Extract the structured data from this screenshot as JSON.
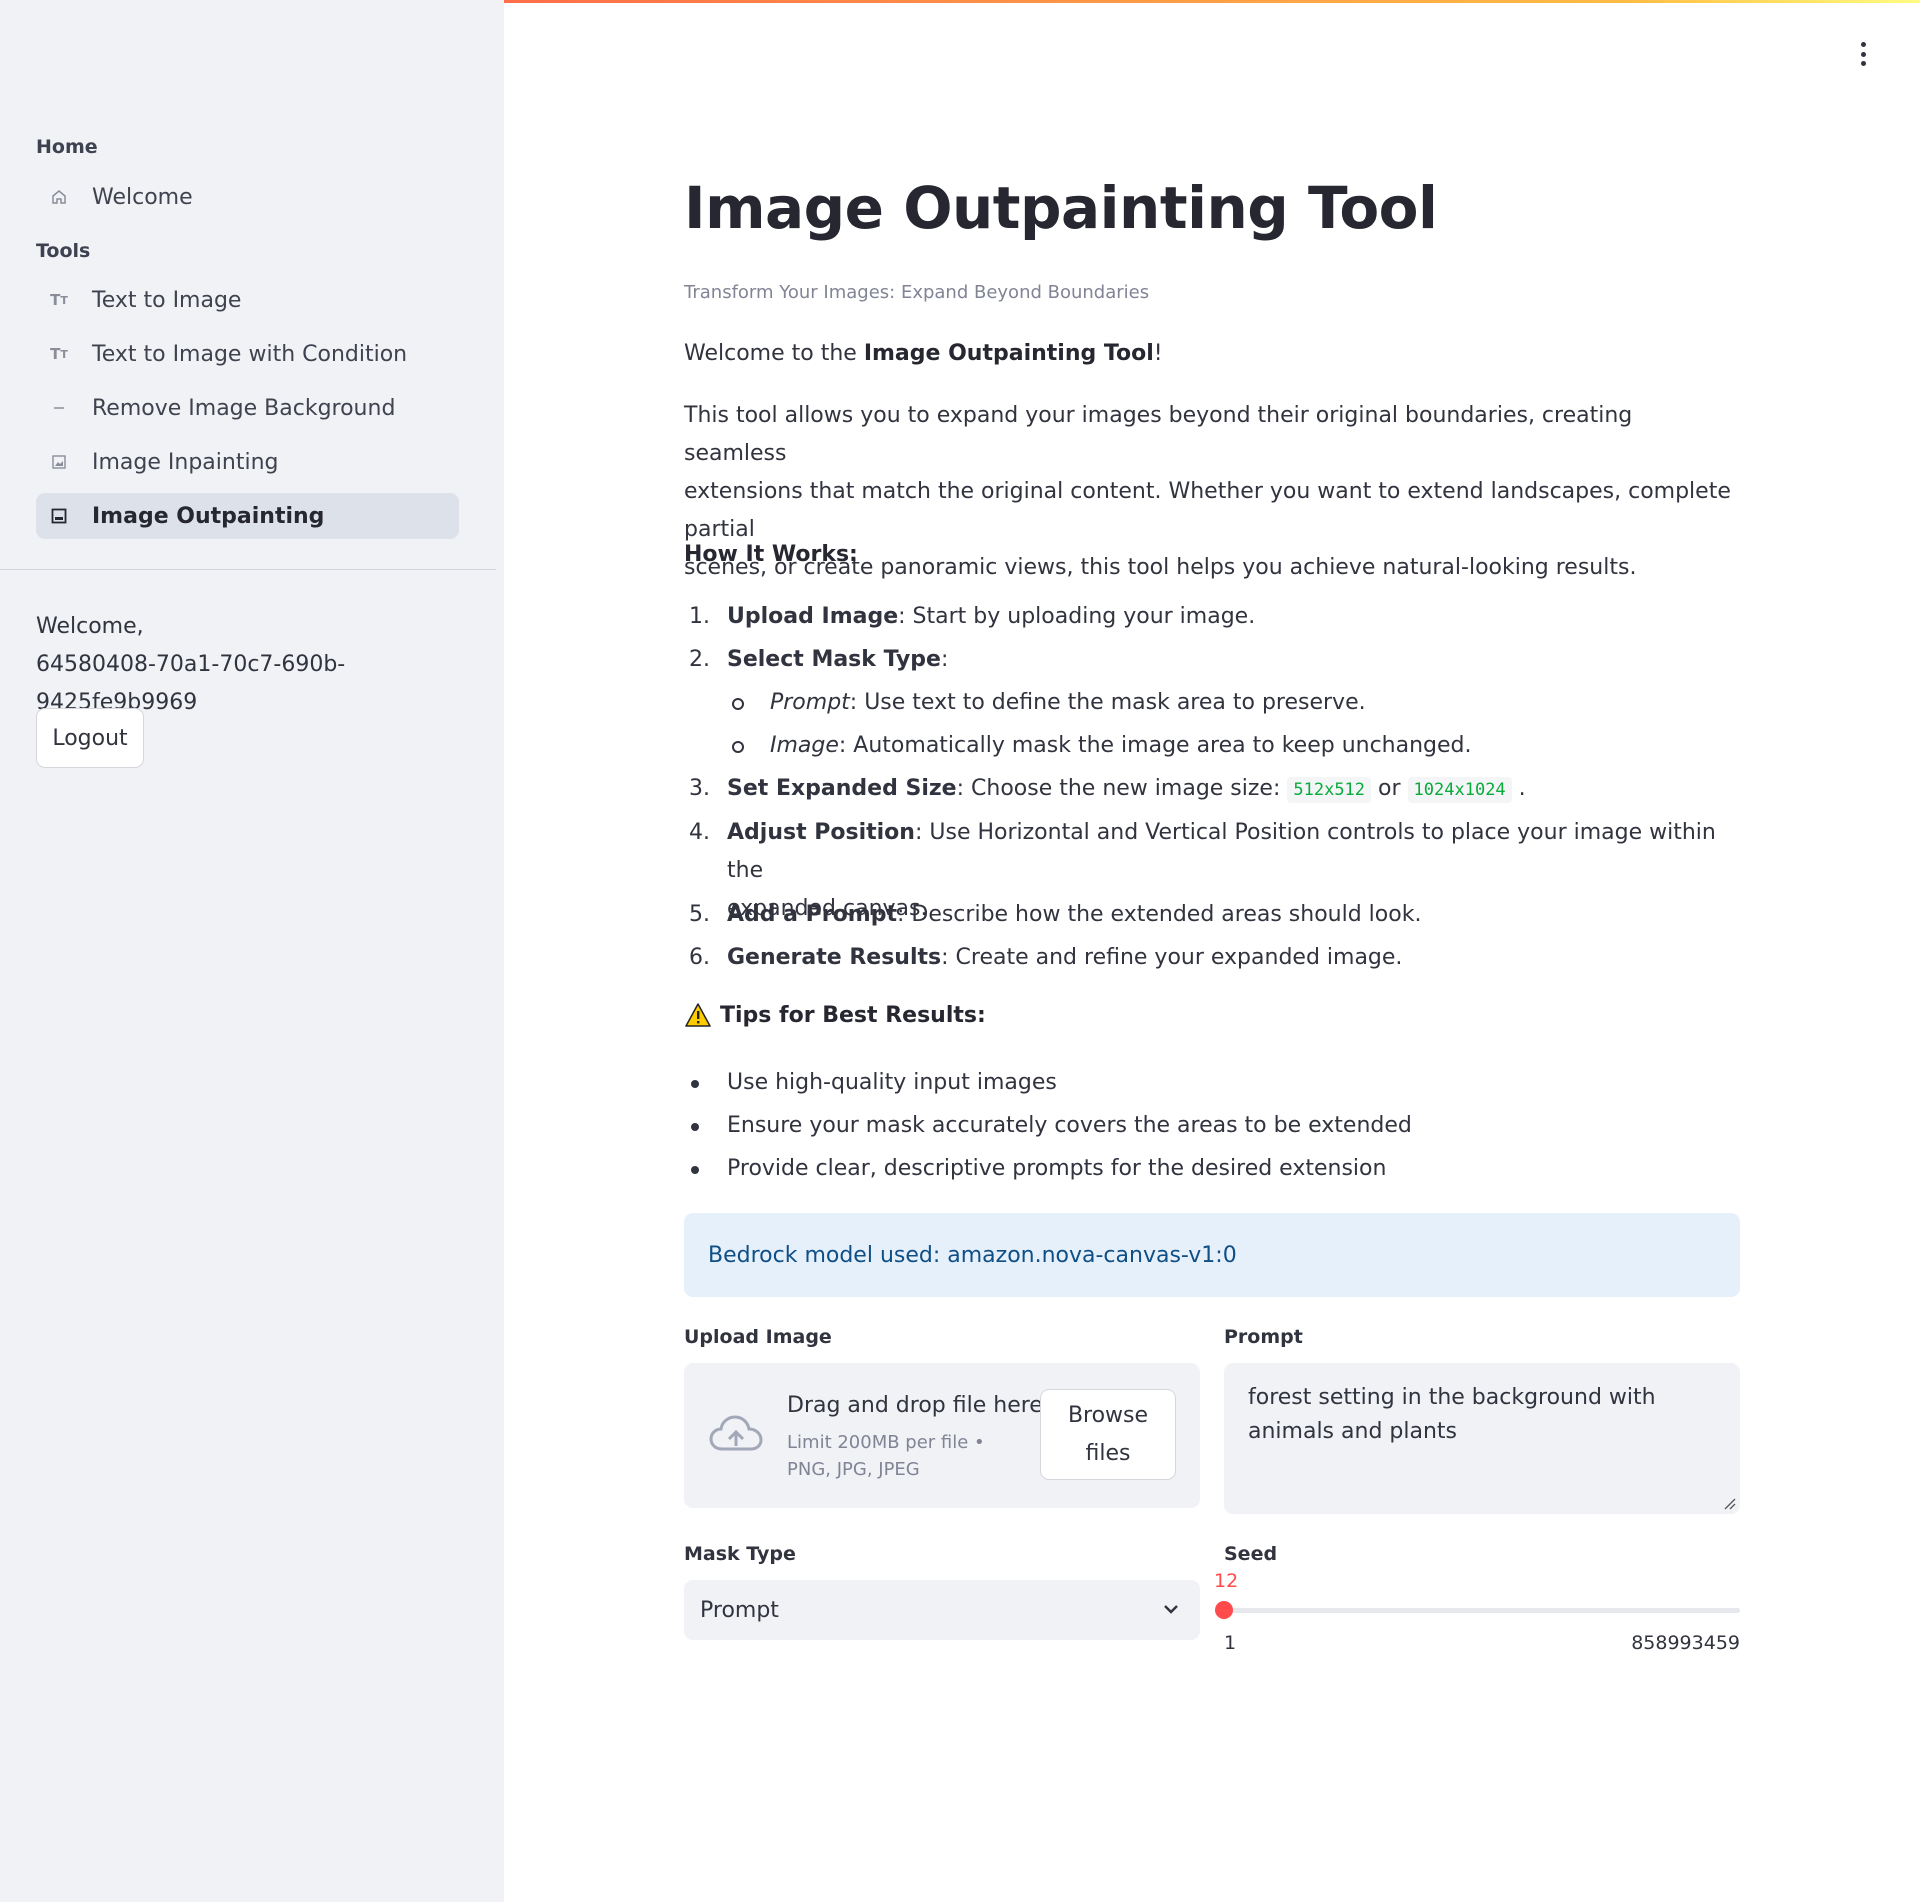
{
  "sidebar": {
    "home_header": "Home",
    "tools_header": "Tools",
    "items": [
      {
        "label": "Welcome",
        "icon": "home-icon"
      },
      {
        "label": "Text to Image",
        "icon": "text-size-icon"
      },
      {
        "label": "Text to Image with Condition",
        "icon": "text-size-icon"
      },
      {
        "label": "Remove Image Background",
        "icon": "dash-icon"
      },
      {
        "label": "Image Inpainting",
        "icon": "image-icon"
      },
      {
        "label": "Image Outpainting",
        "icon": "image-frame-icon",
        "active": true
      }
    ],
    "welcome_label": "Welcome,",
    "user_id": "64580408-70a1-70c7-690b-9425fe9b9969",
    "logout_label": "Logout"
  },
  "main": {
    "title": "Image Outpainting Tool",
    "subtitle": "Transform Your Images: Expand Beyond Boundaries",
    "intro_prefix": "Welcome to the ",
    "intro_bold": "Image Outpainting Tool",
    "intro_suffix": "!",
    "description_line1": "This tool allows you to expand your images beyond their original boundaries, creating seamless",
    "description_line2": "extensions that match the original content. Whether you want to extend landscapes, complete partial",
    "description_line3": "scenes, or create panoramic views, this tool helps you achieve natural-looking results.",
    "how_it_works": "How It Works:",
    "steps": [
      {
        "num": "1.",
        "bold": "Upload Image",
        "text": ": Start by uploading your image."
      },
      {
        "num": "2.",
        "bold": "Select Mask Type",
        "text": ":"
      },
      {
        "num": "3.",
        "bold": "Set Expanded Size",
        "text": ": Choose the new image size: ",
        "code1": "512x512",
        "or": "or",
        "code2": "1024x1024",
        "end": "."
      },
      {
        "num": "4.",
        "bold": "Adjust Position",
        "text": ": Use Horizontal and Vertical Position controls to place your image within the",
        "text2": "expanded canvas."
      },
      {
        "num": "5.",
        "bold": "Add a Prompt",
        "text": ": Describe how the extended areas should look."
      },
      {
        "num": "6.",
        "bold": "Generate Results",
        "text": ": Create and refine your expanded image."
      }
    ],
    "mask_types": [
      {
        "italic": "Prompt",
        "text": ": Use text to define the mask area to preserve."
      },
      {
        "italic": "Image",
        "text": ": Automatically mask the image area to keep unchanged."
      }
    ],
    "tips_header": "Tips for Best Results:",
    "tips": [
      "Use high-quality input images",
      "Ensure your mask accurately covers the areas to be extended",
      "Provide clear, descriptive prompts for the desired extension"
    ],
    "info": "Bedrock model used: amazon.nova-canvas-v1:0",
    "upload": {
      "label": "Upload Image",
      "drag_text": "Drag and drop file here",
      "limit_text": "Limit 200MB per file • PNG, JPG, JPEG",
      "browse_line1": "Browse",
      "browse_line2": "files"
    },
    "prompt": {
      "label": "Prompt",
      "value": "forest setting in the background with animals and plants"
    },
    "mask_type": {
      "label": "Mask Type",
      "selected": "Prompt"
    },
    "seed": {
      "label": "Seed",
      "value": "12",
      "min": "1",
      "max": "858993459"
    }
  },
  "colors": {
    "accent": "#ff4b4b",
    "sidebar_bg": "#f0f2f6",
    "info_bg": "#e6f0fb",
    "info_text": "#0f4f85",
    "code_text": "#09ab3b"
  }
}
